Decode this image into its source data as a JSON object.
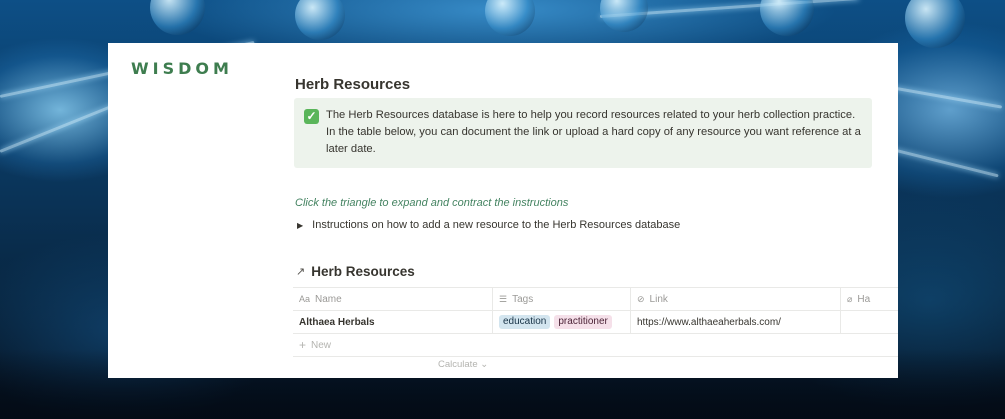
{
  "brand": "WISDOM",
  "page": {
    "title": "Herb Resources",
    "callout": {
      "icon": "check-mark-icon",
      "text": "The Herb Resources database is here to help you record resources related to your herb collection practice. In the table below, you can document the link or upload a hard copy of any resource you want reference at a later date."
    },
    "hint": "Click the triangle to expand and contract the instructions",
    "toggle": "Instructions on how to add a new resource to the Herb Resources database"
  },
  "database": {
    "title": "Herb Resources",
    "columns": [
      {
        "label": "Name",
        "icon": "Aa"
      },
      {
        "label": "Tags",
        "icon": "☰"
      },
      {
        "label": "Link",
        "icon": "⊘"
      },
      {
        "label": "Ha",
        "icon": "⌀"
      }
    ],
    "rows": [
      {
        "name": "Althaea Herbals",
        "tags": [
          "education",
          "practitioner"
        ],
        "link": "https://www.althaeaherbals.com/",
        "hardcopy": ""
      }
    ],
    "new_label": "New",
    "calculate_label": "Calculate ⌄"
  },
  "colors": {
    "brand": "#3e7d4f",
    "callout_bg": "#edf3ec",
    "hint": "#448361",
    "tag_education": "#d3e5ef",
    "tag_practitioner": "#f5e0e9"
  }
}
